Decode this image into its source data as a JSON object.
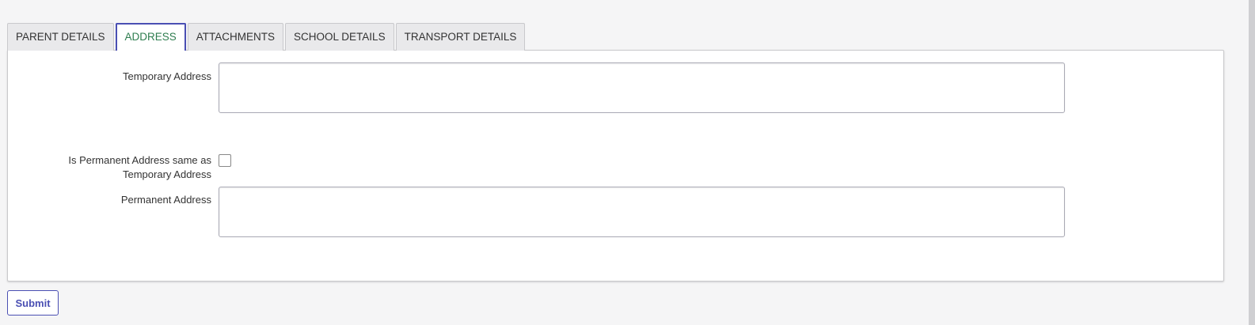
{
  "tabs": [
    {
      "label": "PARENT DETAILS",
      "active": false
    },
    {
      "label": "ADDRESS",
      "active": true
    },
    {
      "label": "ATTACHMENTS",
      "active": false
    },
    {
      "label": "SCHOOL DETAILS",
      "active": false
    },
    {
      "label": "TRANSPORT DETAILS",
      "active": false
    }
  ],
  "form": {
    "temporary_address": {
      "label": "Temporary Address",
      "value": ""
    },
    "same_as_temporary": {
      "label_line1": "Is Permanent Address same as",
      "label_line2": "Temporary Address",
      "checked": false
    },
    "permanent_address": {
      "label": "Permanent Address",
      "value": ""
    }
  },
  "submit_label": "Submit",
  "colors": {
    "accent": "#4a4fb3",
    "active_tab_text": "#2e7d4f",
    "background": "#f5f5f6"
  }
}
